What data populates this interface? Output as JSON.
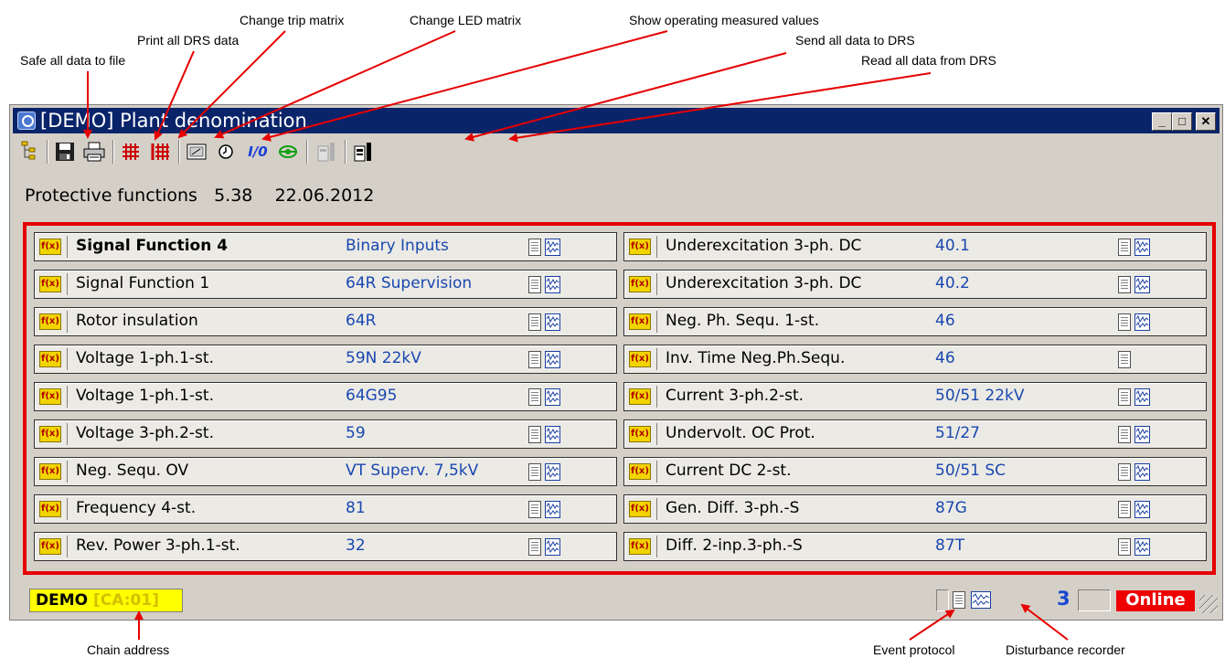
{
  "annotations": {
    "safe_all": "Safe all data to file",
    "print_all": "Print all DRS data",
    "trip_matrix": "Change trip matrix",
    "led_matrix": "Change LED matrix",
    "measured_values": "Show operating measured values",
    "send_all": "Send all data to DRS",
    "read_all": "Read all data from DRS",
    "chain_address": "Chain address",
    "event_protocol": "Event protocol",
    "disturbance_recorder": "Disturbance recorder"
  },
  "window": {
    "title": "[DEMO] Plant denomination",
    "minimize": "_",
    "maximize": "□",
    "close": "✕"
  },
  "toolbar": {
    "icons": [
      "tree-icon",
      "save-icon",
      "print-icon",
      "trip-matrix-icon",
      "led-matrix-icon",
      "measured-values-icon",
      "clock-icon",
      "io-icon",
      "settings-icon",
      "send-to-drs-icon",
      "read-from-drs-icon"
    ],
    "io_label": "I/0"
  },
  "info": {
    "label": "Protective functions",
    "version": "5.38",
    "date": "22.06.2012"
  },
  "functions": {
    "left": [
      {
        "name": "Signal Function 4",
        "code": "Binary Inputs",
        "bold": true
      },
      {
        "name": "Signal Function 1",
        "code": "64R Supervision"
      },
      {
        "name": "Rotor insulation",
        "code": "64R"
      },
      {
        "name": "Voltage 1-ph.1-st.",
        "code": "59N 22kV"
      },
      {
        "name": "Voltage 1-ph.1-st.",
        "code": "64G95"
      },
      {
        "name": "Voltage 3-ph.2-st.",
        "code": "59"
      },
      {
        "name": "Neg. Sequ. OV",
        "code": "VT Superv. 7,5kV"
      },
      {
        "name": "Frequency 4-st.",
        "code": "81"
      },
      {
        "name": "Rev. Power 3-ph.1-st.",
        "code": "32"
      }
    ],
    "right": [
      {
        "name": "Underexcitation 3-ph. DC",
        "code": "40.1"
      },
      {
        "name": "Underexcitation 3-ph. DC",
        "code": "40.2"
      },
      {
        "name": "Neg. Ph. Sequ. 1-st.",
        "code": "46"
      },
      {
        "name": "Inv. Time Neg.Ph.Sequ.",
        "code": "46",
        "no_recorder": true
      },
      {
        "name": "Current 3-ph.2-st.",
        "code": "50/51 22kV"
      },
      {
        "name": "Undervolt. OC Prot.",
        "code": "51/27"
      },
      {
        "name": "Current DC 2-st.",
        "code": "50/51 SC"
      },
      {
        "name": "Gen. Diff. 3-ph.-S",
        "code": "87G"
      },
      {
        "name": "Diff. 2-inp.3-ph.-S",
        "code": "87T"
      }
    ],
    "fx_label": "f(x)"
  },
  "status": {
    "device": "DEMO",
    "chain_address": "[CA:01]",
    "recorder_count": "3",
    "connection": "Online"
  },
  "colors": {
    "titlebar": "#0a246a",
    "highlight_border": "#e60000",
    "code_text": "#1848b0",
    "online_bg": "#ee0000",
    "chain_bg": "#ffff00",
    "arrow": "#e60000"
  }
}
